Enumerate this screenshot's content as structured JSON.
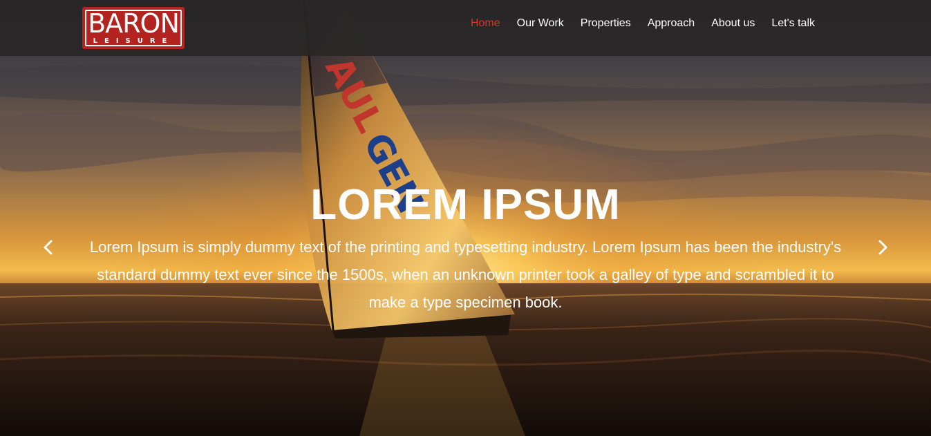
{
  "logo": {
    "word": "BARON",
    "sub": "LEISURE"
  },
  "nav": {
    "items": [
      {
        "label": "Home",
        "active": true
      },
      {
        "label": "Our Work",
        "active": false
      },
      {
        "label": "Properties",
        "active": false
      },
      {
        "label": "Approach",
        "active": false
      },
      {
        "label": "About us",
        "active": false
      },
      {
        "label": "Let's talk",
        "active": false
      }
    ]
  },
  "hero": {
    "title": "LOREM IPSUM",
    "text": "Lorem Ipsum is simply dummy text of the printing and typesetting industry. Lorem Ipsum has been the industry's standard dummy text ever since the 1500s, when an unknown printer took a galley of type and scrambled it to make a type specimen book.",
    "prev_icon": "chevron-left-icon",
    "next_icon": "chevron-right-icon",
    "background_image": "sailboat-at-sunset-photo"
  },
  "colors": {
    "nav_bg": "#282626",
    "nav_active": "#d0392e",
    "logo_red": "#b3231f",
    "text": "#ffffff"
  }
}
